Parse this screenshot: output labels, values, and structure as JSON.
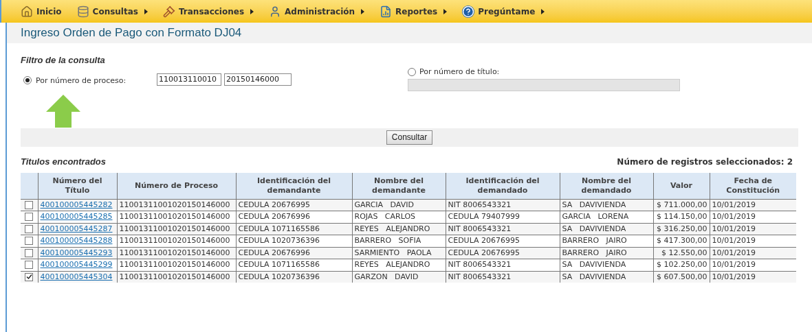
{
  "nav": [
    {
      "label": "Inicio",
      "has_menu": false
    },
    {
      "label": "Consultas",
      "has_menu": true
    },
    {
      "label": "Transacciones",
      "has_menu": true
    },
    {
      "label": "Administración",
      "has_menu": true
    },
    {
      "label": "Reportes",
      "has_menu": true
    },
    {
      "label": "Pregúntame",
      "has_menu": true
    }
  ],
  "page_title": "Ingreso Orden de Pago con Formato DJ04",
  "filter": {
    "title": "Filtro de la consulta",
    "by_process": {
      "label": "Por número de proceso:",
      "selected": true,
      "values": [
        "110013110010",
        "20150146000"
      ]
    },
    "by_title": {
      "label": "Por número de título:",
      "selected": false,
      "disabled": true
    },
    "button": "Consultar"
  },
  "results": {
    "title": "Titulos encontrados",
    "count": "Número de registros seleccionados: 2",
    "columns": [
      "Número del Título",
      "Número de Proceso",
      "Identificación del demandante",
      "Nombre del demandante",
      "Identificación del demandado",
      "Nombre del demandado",
      "Valor",
      "Fecha de Constitución"
    ],
    "rows": [
      {
        "checked": false,
        "cells": [
          "400100005445282",
          "11001311001020150146000",
          "CEDULA 20676995",
          "GARCIA   DAVID",
          "NIT 8006543321",
          "SA   DAVIVIENDA",
          "$ 711.000,00",
          "10/01/2019"
        ]
      },
      {
        "checked": false,
        "cells": [
          "400100005445285",
          "11001311001020150146000",
          "CEDULA 20676996",
          "ROJAS   CARLOS",
          "CEDULA 79407999",
          "GARCIA   LORENA",
          "$ 114.150,00",
          "10/01/2019"
        ]
      },
      {
        "checked": false,
        "cells": [
          "400100005445287",
          "11001311001020150146000",
          "CEDULA 1071165586",
          "REYES   ALEJANDRO",
          "NIT 8006543321",
          "SA   DAVIVIENDA",
          "$ 316.250,00",
          "10/01/2019"
        ]
      },
      {
        "checked": false,
        "cells": [
          "400100005445288",
          "11001311001020150146000",
          "CEDULA 1020736396",
          "BARRERO   SOFIA",
          "CEDULA 20676995",
          "BARRERO   JAIRO",
          "$ 417.300,00",
          "10/01/2019"
        ]
      },
      {
        "checked": false,
        "cells": [
          "400100005445293",
          "11001311001020150146000",
          "CEDULA 20676996",
          "SARMIENTO   PAOLA",
          "CEDULA 20676995",
          "BARRERO   JAIRO",
          "$ 12.550,00",
          "10/01/2019"
        ]
      },
      {
        "checked": false,
        "cells": [
          "400100005445299",
          "11001311001020150146000",
          "CEDULA 1071165586",
          "REYES   ALEJANDRO",
          "NIT 8006543321",
          "SA   DAVIVIENDA",
          "$ 102.250,00",
          "10/01/2019"
        ]
      },
      {
        "checked": true,
        "cells": [
          "400100005445304",
          "11001311001020150146000",
          "CEDULA 1020736396",
          "GARZON   DAVID",
          "NIT 8006543321",
          "SA   DAVIVIENDA",
          "$ 607.500,00",
          "10/01/2019"
        ]
      }
    ]
  }
}
